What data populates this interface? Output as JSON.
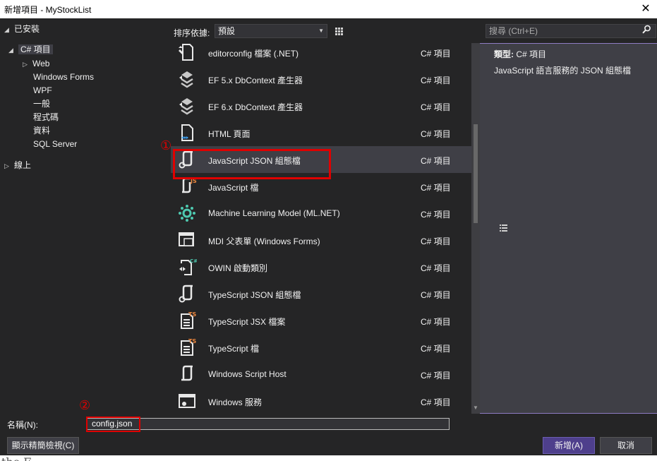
{
  "window": {
    "title": "新增項目 - MyStockList",
    "close_glyph": "✕"
  },
  "tree": {
    "installed": "已安裝",
    "csharp_items": "C# 項目",
    "children": [
      "Web",
      "Windows Forms",
      "WPF",
      "一般",
      "程式碼",
      "資料",
      "SQL Server"
    ],
    "online": "線上"
  },
  "toolbar": {
    "sort_label": "排序依據:",
    "sort_value": "預設",
    "search_placeholder": "搜尋 (Ctrl+E)"
  },
  "templates": [
    {
      "name": "editorconfig 檔案 (.NET)",
      "category": "C# 項目",
      "icon": "editorconfig-icon"
    },
    {
      "name": "EF 5.x DbContext 產生器",
      "category": "C# 項目",
      "icon": "ef-generator-icon"
    },
    {
      "name": "EF 6.x DbContext 產生器",
      "category": "C# 項目",
      "icon": "ef-generator-icon"
    },
    {
      "name": "HTML 頁面",
      "category": "C# 項目",
      "icon": "html-page-icon"
    },
    {
      "name": "JavaScript JSON 組態檔",
      "category": "C# 項目",
      "icon": "json-config-icon"
    },
    {
      "name": "JavaScript 檔",
      "category": "C# 項目",
      "icon": "javascript-file-icon"
    },
    {
      "name": "Machine Learning Model (ML.NET)",
      "category": "C# 項目",
      "icon": "ml-model-icon"
    },
    {
      "name": "MDI 父表單 (Windows Forms)",
      "category": "C# 項目",
      "icon": "mdi-form-icon"
    },
    {
      "name": "OWIN 啟動類別",
      "category": "C# 項目",
      "icon": "owin-class-icon"
    },
    {
      "name": "TypeScript JSON 組態檔",
      "category": "C# 項目",
      "icon": "json-config-icon"
    },
    {
      "name": "TypeScript JSX 檔案",
      "category": "C# 項目",
      "icon": "typescript-jsx-icon"
    },
    {
      "name": "TypeScript 檔",
      "category": "C# 項目",
      "icon": "typescript-file-icon"
    },
    {
      "name": "Windows Script Host",
      "category": "C# 項目",
      "icon": "script-host-icon"
    },
    {
      "name": "Windows 服務",
      "category": "C# 項目",
      "icon": "windows-service-icon"
    }
  ],
  "details": {
    "type_label": "類型:",
    "type_value": "C# 項目",
    "description": "JavaScript 語言服務的 JSON 組態檔"
  },
  "bottom": {
    "name_label": "名稱(N):",
    "name_value": "config.json",
    "compact_view": "顯示精簡檢視(C)",
    "add_button": "新增(A)",
    "cancel_button": "取消"
  },
  "annotations": {
    "marker1": "①",
    "marker2": "②"
  },
  "below_text": "the F"
}
